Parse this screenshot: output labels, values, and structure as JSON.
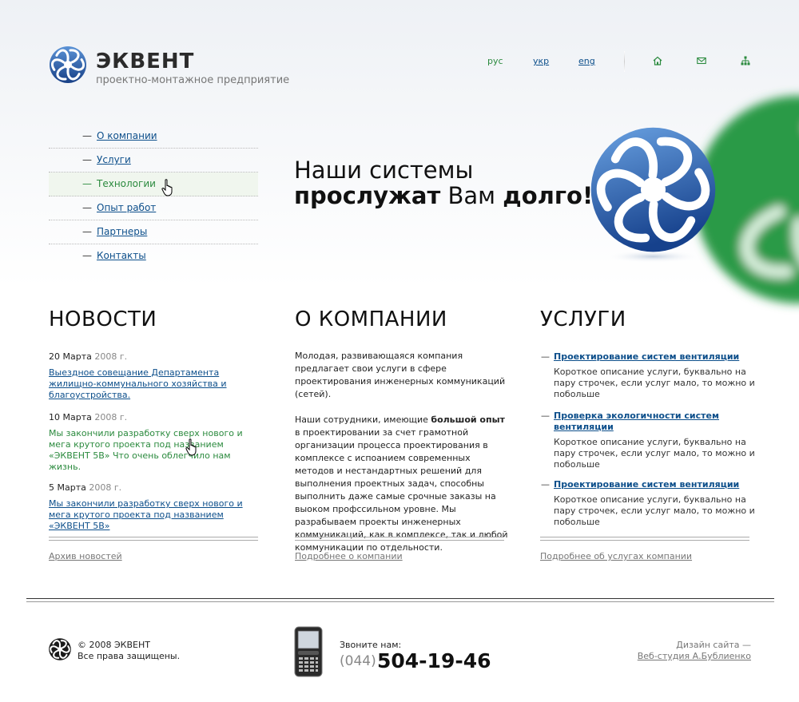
{
  "brand": {
    "name": "ЭКВЕНТ",
    "tagline": "проектно-монтажное предприятие",
    "colors": {
      "blue": "#1e5aa8",
      "green": "#2b8a3e",
      "link": "#0d4f8b"
    }
  },
  "header": {
    "langs": [
      "рус",
      "укр",
      "eng"
    ],
    "icons": [
      "home-icon",
      "mail-icon",
      "sitemap-icon"
    ]
  },
  "menu": {
    "items": [
      "О компании",
      "Услуги",
      "Технологии",
      "Опыт работ",
      "Партнеры",
      "Контакты"
    ],
    "active_index": 2
  },
  "slogan": {
    "line1": "Наши системы",
    "bold1": "прослужат",
    "mid": " Вам ",
    "bold2": "долго!"
  },
  "news": {
    "title": "НОВОСТИ",
    "items": [
      {
        "date": "20 Марта",
        "year": "2008 г.",
        "text": "Выездное совещание Департамента жилищно-коммунального хозяйства и благоустройства."
      },
      {
        "date": "10 Марта",
        "year": "2008 г.",
        "text": "Мы закончили разработку сверх нового и мега крутого проекта под названием «ЭКВЕНТ 5В» Что очень облегчило нам жизнь."
      },
      {
        "date": "5 Марта",
        "year": "2008 г.",
        "text": "Мы закончили разработку сверх нового и мега крутого проекта под названием «ЭКВЕНТ 5В»"
      }
    ],
    "more": "Архив новостей"
  },
  "about": {
    "title": "О КОМПАНИИ",
    "p1": "Молодая, развивающаяся компания предлагает свои услуги в сфере проектирования инженерных коммуникаций (сетей).",
    "p2_before": "Наши сотрудники, имеющие ",
    "p2_bold": "большой опыт",
    "p2_after": " в проектировании за счет грамотной организации процесса проектирования в комплексе с испоанием современных методов и нестандартных решений для выполнения проектных задач, способны выполнить даже самые срочные заказы на выоком профссильном уровне. Мы разрабываем проекты инженерных коммуникаций, как в комплексе, так и любой коммуникации по отдельности.",
    "more": "Подробнее о компании"
  },
  "services": {
    "title": "УСЛУГИ",
    "items": [
      {
        "title": "Проектирование систем вентиляции",
        "desc": "Короткое описание услуги, буквально на пару строчек, если услуг мало, то можно и побольше"
      },
      {
        "title": "Проверка экологичности систем вентиляции",
        "desc": "Короткое описание услуги, буквально на пару строчек, если услуг мало, то можно и побольше"
      },
      {
        "title": "Проектирование систем вентиляции",
        "desc": "Короткое описание услуги, буквально на пару строчек, если услуг мало, то можно и побольше"
      }
    ],
    "more": "Подробнее об услугах компании"
  },
  "footer": {
    "copyright": "© 2008 ЭКВЕНТ",
    "rights": "Все права защищены.",
    "call_label": "Звоните нам:",
    "phone_code": "(044)",
    "phone_number": "504-19-46",
    "design_label": "Дизайн сайта —",
    "design_link": "Веб-студия А.Бублиенко"
  }
}
